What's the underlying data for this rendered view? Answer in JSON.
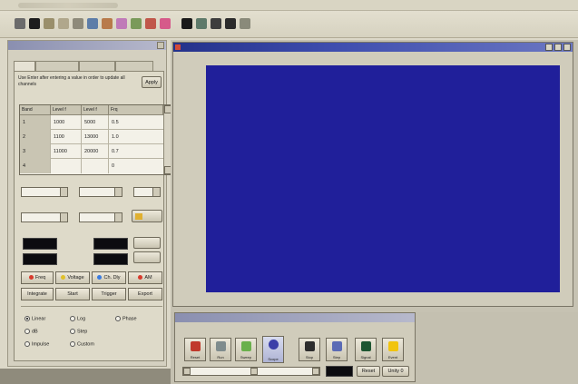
{
  "colors": {
    "scope_screen": "#201f9a",
    "title_bar": "#2e3b98",
    "panel_bg": "#d4d0c0"
  },
  "toolbar": {
    "icons": [
      "open-icon",
      "save-icon",
      "pencil-icon",
      "text-icon",
      "cut-icon",
      "copy-icon",
      "paste-icon",
      "image-icon",
      "chart-icon",
      "palette-icon",
      "stop-icon",
      "play-icon",
      "record-icon",
      "settings-icon",
      "help-icon"
    ]
  },
  "panel": {
    "info_text": "Use Enter after entering a value in order to update all channels",
    "apply_label": "Apply",
    "table": {
      "headers": [
        "Band",
        "Level f",
        "Level f",
        "Frq"
      ],
      "rows": [
        [
          "1",
          "1000",
          "5000",
          "0.5"
        ],
        [
          "2",
          "1100",
          "13000",
          "1.0"
        ],
        [
          "3",
          "11000",
          "20000",
          "0.7"
        ],
        [
          "4",
          "",
          "",
          "0"
        ]
      ]
    },
    "modes": [
      {
        "label": "Freq",
        "dot": "#d83a2c",
        "state": "selected"
      },
      {
        "label": "Voltage",
        "dot": "#e0c02a",
        "state": ""
      },
      {
        "label": "Ch. Dly",
        "dot": "#3a7be0",
        "state": ""
      },
      {
        "label": "AM",
        "dot": "#d83a2c",
        "state": ""
      }
    ],
    "actions": [
      "Integrate",
      "Start",
      "Trigger",
      "Export"
    ],
    "radios": [
      {
        "label": "Linear",
        "checked": true
      },
      {
        "label": "Log",
        "checked": false
      },
      {
        "label": "Phase",
        "checked": false
      },
      {
        "label": "dB",
        "checked": false
      },
      {
        "label": "Step",
        "checked": false
      },
      {
        "label": "Custom",
        "checked": false
      },
      {
        "label": "Impulse",
        "checked": false
      }
    ]
  },
  "signal_panel": {
    "buttons": [
      {
        "label": "Reset",
        "icon": "reset-icon",
        "color": "#c0392b"
      },
      {
        "label": "Run",
        "icon": "run-icon",
        "color": "#7f8c8d"
      },
      {
        "label": "Sweep",
        "icon": "sweep-icon",
        "color": "#6ab04c"
      },
      {
        "label": "Scope",
        "icon": "scope-icon",
        "color": "#3b3fa8"
      },
      {
        "label": "Stop",
        "icon": "stop-icon",
        "color": "#2d2d2d"
      },
      {
        "label": "Step",
        "icon": "step-icon",
        "color": "#5b6bb5"
      },
      {
        "label": "Signal",
        "icon": "signal-icon",
        "color": "#1e5631"
      },
      {
        "label": "Event",
        "icon": "event-icon",
        "color": "#f1c40f"
      }
    ],
    "reset_label": "Reset",
    "unity_label": "Unity 0"
  }
}
